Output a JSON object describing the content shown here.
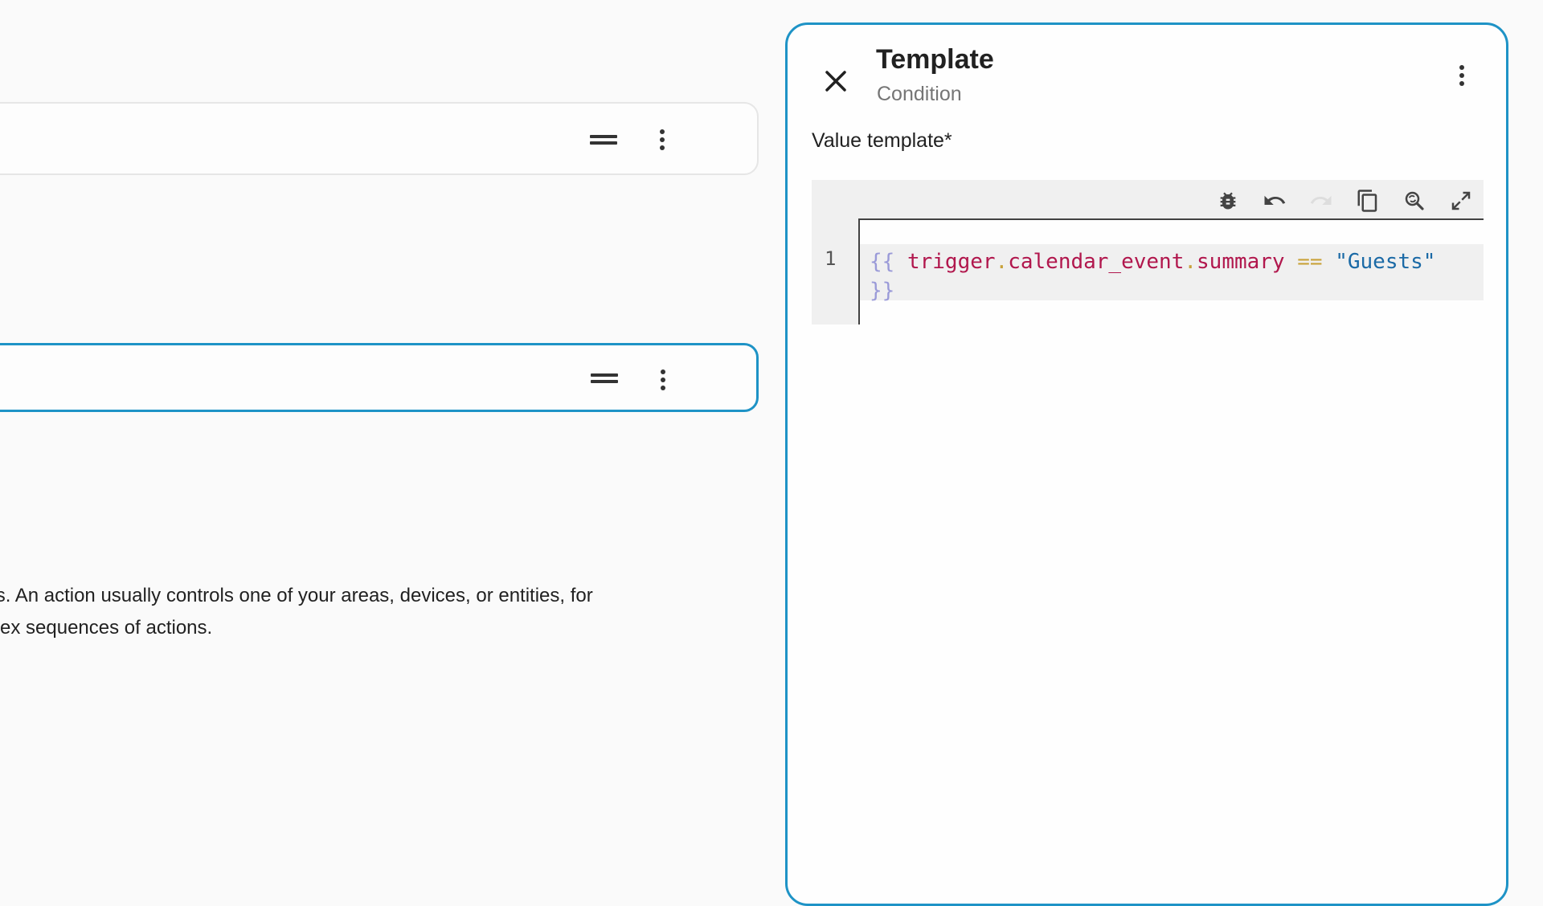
{
  "left": {
    "description_lines": [
      "uns. An action usually controls one of your areas, devices, or entities, for",
      "nplex sequences of actions."
    ]
  },
  "panel": {
    "title": "Template",
    "subtitle": "Condition",
    "field_label": "Value template*",
    "editor": {
      "line_number": "1",
      "code": {
        "open_brace": "{{",
        "var1": "trigger",
        "dot1": ".",
        "var2": "calendar_event",
        "dot2": ".",
        "var3": "summary",
        "op": "==",
        "string": "\"Guests\"",
        "close_brace": "}}"
      },
      "toolbar_icons": [
        "bug-icon",
        "undo-icon",
        "redo-icon",
        "copy-icon",
        "search-replace-icon",
        "fullscreen-icon"
      ]
    }
  },
  "colors": {
    "accent": "#1e93c6",
    "background": "#fafafa",
    "code_variable": "#b1174d",
    "code_string": "#1b6aa6",
    "code_brace": "#9a9ad8",
    "code_operator": "#c9a23a"
  }
}
